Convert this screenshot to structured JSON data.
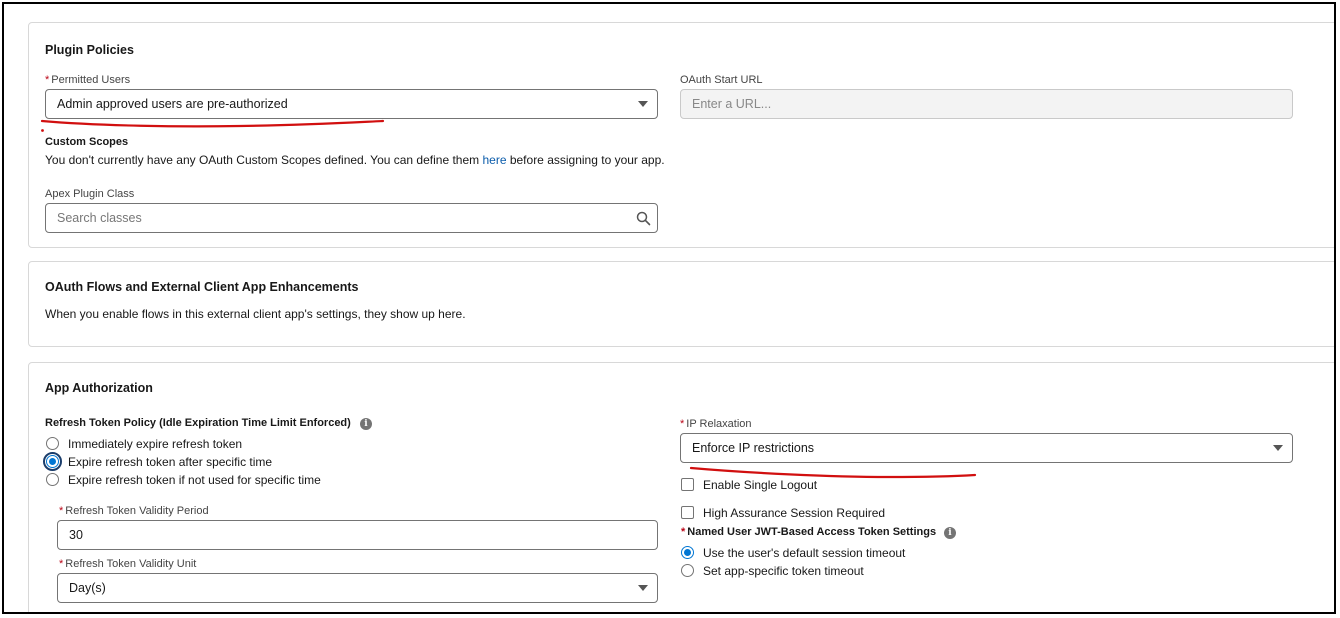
{
  "plugin_policies": {
    "title": "Plugin Policies",
    "permitted_users": {
      "label": "Permitted Users",
      "required_mark": "*",
      "value": "Admin approved users are pre-authorized"
    },
    "oauth_start_url": {
      "label": "OAuth Start URL",
      "placeholder": "Enter a URL..."
    },
    "custom_scopes": {
      "title": "Custom Scopes",
      "text_before": "You don't currently have any OAuth Custom Scopes defined. You can define them ",
      "link": "here",
      "text_after": " before assigning to your app."
    },
    "apex_plugin_class": {
      "label": "Apex Plugin Class",
      "placeholder": "Search classes"
    }
  },
  "oauth_flows": {
    "title": "OAuth Flows and External Client App Enhancements",
    "description": "When you enable flows in this external client app's settings, they show up here."
  },
  "app_authorization": {
    "title": "App Authorization",
    "refresh_policy": {
      "label": "Refresh Token Policy (Idle Expiration Time Limit Enforced)",
      "options": [
        {
          "label": "Immediately expire refresh token",
          "selected": false
        },
        {
          "label": "Expire refresh token after specific time",
          "selected": true
        },
        {
          "label": "Expire refresh token if not used for specific time",
          "selected": false
        }
      ]
    },
    "validity_period": {
      "label": "Refresh Token Validity Period",
      "required_mark": "*",
      "value": "30"
    },
    "validity_unit": {
      "label": "Refresh Token Validity Unit",
      "required_mark": "*",
      "value": "Day(s)"
    },
    "ip_relaxation": {
      "label": "IP Relaxation",
      "required_mark": "*",
      "value": "Enforce IP restrictions"
    },
    "enable_single_logout": {
      "label": "Enable Single Logout",
      "checked": false
    },
    "high_assurance": {
      "label": "High Assurance Session Required",
      "checked": false
    },
    "named_user_jwt": {
      "label": "Named User JWT-Based Access Token Settings",
      "required_mark": "*",
      "options": [
        {
          "label": "Use the user's default session timeout",
          "selected": true
        },
        {
          "label": "Set app-specific token timeout",
          "selected": false
        }
      ]
    }
  },
  "icons": {
    "select_caret": "chevron-down-icon",
    "search": "search-icon",
    "info": "info-icon"
  },
  "colors": {
    "accent": "#0176d3",
    "link": "#0b5cab",
    "required": "#ba0517",
    "annotation": "#d10f0f"
  }
}
